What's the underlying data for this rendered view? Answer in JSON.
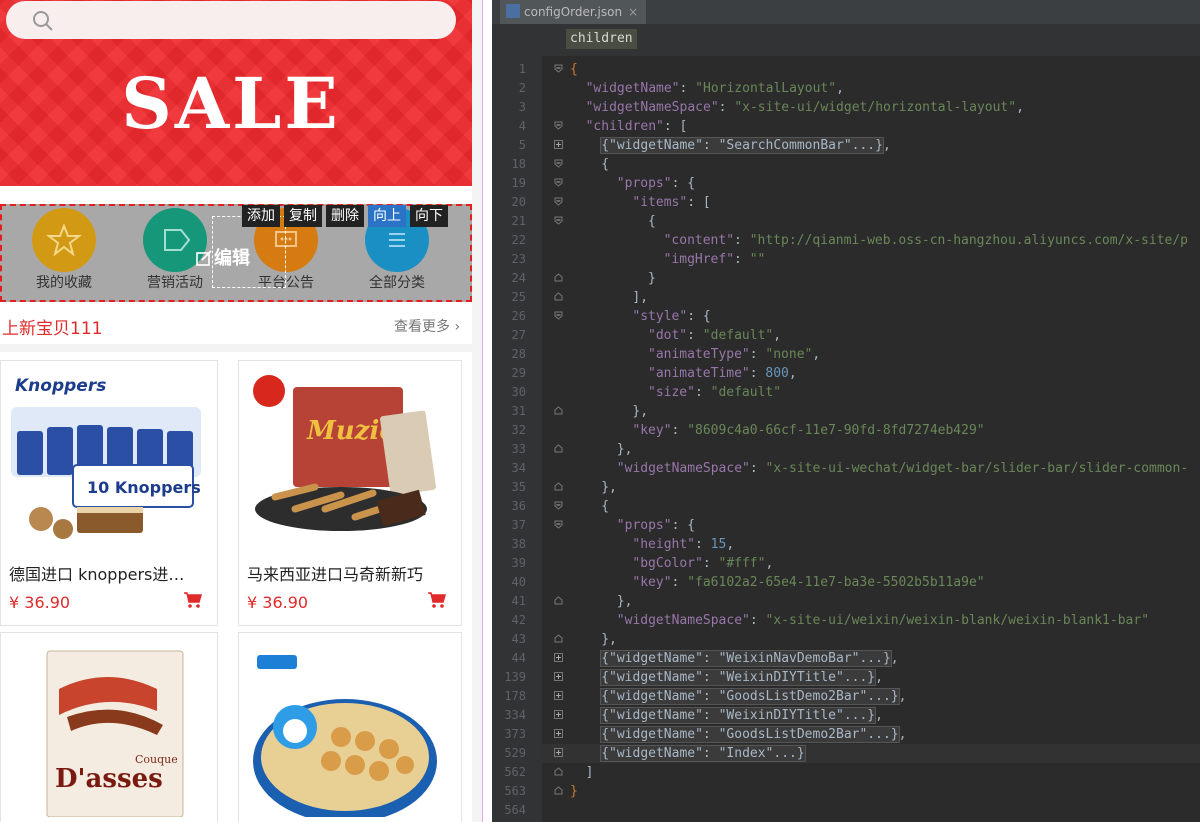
{
  "preview": {
    "banner_text": "SALE",
    "nav_items": [
      {
        "label": "我的收藏",
        "color": "#d29a14"
      },
      {
        "label": "营销活动",
        "color": "#16977a"
      },
      {
        "label": "平台公告",
        "color": "#d67b12"
      },
      {
        "label": "全部分类",
        "color": "#1a8fc4"
      }
    ],
    "actions": [
      "添加",
      "复制",
      "删除",
      "向上",
      "向下"
    ],
    "edit_overlay": "编辑",
    "section_title": "上新宝贝111",
    "more_link": "查看更多",
    "goods": [
      {
        "name": "德国进口 knoppers进…",
        "price": "¥ 36.90"
      },
      {
        "name": "马来西亚进口马奇新新巧",
        "price": "¥ 36.90"
      }
    ],
    "image_texts": {
      "knoppers_logo": "Knoppers",
      "knoppers_pack": "10 Knoppers",
      "muzic": "Muzic",
      "dasses_1": "Couque",
      "dasses_2": "D'asses"
    }
  },
  "editor": {
    "tab_label": "configOrder.json",
    "breadcrumb": "children",
    "lines": [
      {
        "num": "1",
        "indent": 0,
        "tokens": [
          [
            "p",
            "{"
          ]
        ]
      },
      {
        "num": "2",
        "indent": 1,
        "tokens": [
          [
            "k",
            "\"widgetName\""
          ],
          [
            "t",
            ": "
          ],
          [
            "s",
            "\"HorizontalLayout\""
          ],
          [
            "t",
            ","
          ]
        ]
      },
      {
        "num": "3",
        "indent": 1,
        "tokens": [
          [
            "k",
            "\"widgetNameSpace\""
          ],
          [
            "t",
            ": "
          ],
          [
            "s",
            "\"x-site-ui/widget/horizontal-layout\""
          ],
          [
            "t",
            ","
          ]
        ]
      },
      {
        "num": "4",
        "indent": 1,
        "tokens": [
          [
            "k",
            "\"children\""
          ],
          [
            "t",
            ": ["
          ]
        ]
      },
      {
        "num": "5",
        "indent": 2,
        "tokens": [
          [
            "c",
            "{\"widgetName\": \"SearchCommonBar\"...}"
          ],
          [
            "t",
            ","
          ]
        ]
      },
      {
        "num": "18",
        "indent": 2,
        "tokens": [
          [
            "t",
            "{"
          ]
        ]
      },
      {
        "num": "19",
        "indent": 3,
        "tokens": [
          [
            "k",
            "\"props\""
          ],
          [
            "t",
            ": {"
          ]
        ]
      },
      {
        "num": "20",
        "indent": 4,
        "tokens": [
          [
            "k",
            "\"items\""
          ],
          [
            "t",
            ": ["
          ]
        ]
      },
      {
        "num": "21",
        "indent": 5,
        "tokens": [
          [
            "t",
            "{"
          ]
        ]
      },
      {
        "num": "22",
        "indent": 6,
        "tokens": [
          [
            "k",
            "\"content\""
          ],
          [
            "t",
            ": "
          ],
          [
            "s",
            "\"http://qianmi-web.oss-cn-hangzhou.aliyuncs.com/x-site/p"
          ]
        ]
      },
      {
        "num": "23",
        "indent": 6,
        "tokens": [
          [
            "k",
            "\"imgHref\""
          ],
          [
            "t",
            ": "
          ],
          [
            "s",
            "\"\""
          ]
        ]
      },
      {
        "num": "24",
        "indent": 5,
        "tokens": [
          [
            "t",
            "}"
          ]
        ]
      },
      {
        "num": "25",
        "indent": 4,
        "tokens": [
          [
            "t",
            "],"
          ]
        ]
      },
      {
        "num": "26",
        "indent": 4,
        "tokens": [
          [
            "k",
            "\"style\""
          ],
          [
            "t",
            ": {"
          ]
        ]
      },
      {
        "num": "27",
        "indent": 5,
        "tokens": [
          [
            "k",
            "\"dot\""
          ],
          [
            "t",
            ": "
          ],
          [
            "s",
            "\"default\""
          ],
          [
            "t",
            ","
          ]
        ]
      },
      {
        "num": "28",
        "indent": 5,
        "tokens": [
          [
            "k",
            "\"animateType\""
          ],
          [
            "t",
            ": "
          ],
          [
            "s",
            "\"none\""
          ],
          [
            "t",
            ","
          ]
        ]
      },
      {
        "num": "29",
        "indent": 5,
        "tokens": [
          [
            "k",
            "\"animateTime\""
          ],
          [
            "t",
            ": "
          ],
          [
            "n",
            "800"
          ],
          [
            "t",
            ","
          ]
        ]
      },
      {
        "num": "30",
        "indent": 5,
        "tokens": [
          [
            "k",
            "\"size\""
          ],
          [
            "t",
            ": "
          ],
          [
            "s",
            "\"default\""
          ]
        ]
      },
      {
        "num": "31",
        "indent": 4,
        "tokens": [
          [
            "t",
            "},"
          ]
        ]
      },
      {
        "num": "32",
        "indent": 4,
        "tokens": [
          [
            "k",
            "\"key\""
          ],
          [
            "t",
            ": "
          ],
          [
            "s",
            "\"8609c4a0-66cf-11e7-90fd-8fd7274eb429\""
          ]
        ]
      },
      {
        "num": "33",
        "indent": 3,
        "tokens": [
          [
            "t",
            "},"
          ]
        ]
      },
      {
        "num": "34",
        "indent": 3,
        "tokens": [
          [
            "k",
            "\"widgetNameSpace\""
          ],
          [
            "t",
            ": "
          ],
          [
            "s",
            "\"x-site-ui-wechat/widget-bar/slider-bar/slider-common-"
          ]
        ]
      },
      {
        "num": "35",
        "indent": 2,
        "tokens": [
          [
            "t",
            "},"
          ]
        ]
      },
      {
        "num": "36",
        "indent": 2,
        "tokens": [
          [
            "t",
            "{"
          ]
        ]
      },
      {
        "num": "37",
        "indent": 3,
        "tokens": [
          [
            "k",
            "\"props\""
          ],
          [
            "t",
            ": {"
          ]
        ]
      },
      {
        "num": "38",
        "indent": 4,
        "tokens": [
          [
            "k",
            "\"height\""
          ],
          [
            "t",
            ": "
          ],
          [
            "n",
            "15"
          ],
          [
            "t",
            ","
          ]
        ]
      },
      {
        "num": "39",
        "indent": 4,
        "tokens": [
          [
            "k",
            "\"bgColor\""
          ],
          [
            "t",
            ": "
          ],
          [
            "s",
            "\"#fff\""
          ],
          [
            "t",
            ","
          ]
        ]
      },
      {
        "num": "40",
        "indent": 4,
        "tokens": [
          [
            "k",
            "\"key\""
          ],
          [
            "t",
            ": "
          ],
          [
            "s",
            "\"fa6102a2-65e4-11e7-ba3e-5502b5b11a9e\""
          ]
        ]
      },
      {
        "num": "41",
        "indent": 3,
        "tokens": [
          [
            "t",
            "},"
          ]
        ]
      },
      {
        "num": "42",
        "indent": 3,
        "tokens": [
          [
            "k",
            "\"widgetNameSpace\""
          ],
          [
            "t",
            ": "
          ],
          [
            "s",
            "\"x-site-ui/weixin/weixin-blank/weixin-blank1-bar\""
          ]
        ]
      },
      {
        "num": "43",
        "indent": 2,
        "tokens": [
          [
            "t",
            "},"
          ]
        ]
      },
      {
        "num": "44",
        "indent": 2,
        "tokens": [
          [
            "c",
            "{\"widgetName\": \"WeixinNavDemoBar\"...}"
          ],
          [
            "t",
            ","
          ]
        ]
      },
      {
        "num": "139",
        "indent": 2,
        "tokens": [
          [
            "c",
            "{\"widgetName\": \"WeixinDIYTitle\"...}"
          ],
          [
            "t",
            ","
          ]
        ]
      },
      {
        "num": "178",
        "indent": 2,
        "tokens": [
          [
            "c",
            "{\"widgetName\": \"GoodsListDemo2Bar\"...}"
          ],
          [
            "t",
            ","
          ]
        ]
      },
      {
        "num": "334",
        "indent": 2,
        "tokens": [
          [
            "c",
            "{\"widgetName\": \"WeixinDIYTitle\"...}"
          ],
          [
            "t",
            ","
          ]
        ]
      },
      {
        "num": "373",
        "indent": 2,
        "tokens": [
          [
            "c",
            "{\"widgetName\": \"GoodsListDemo2Bar\"...}"
          ],
          [
            "t",
            ","
          ]
        ]
      },
      {
        "num": "529",
        "indent": 2,
        "tokens": [
          [
            "c",
            "{\"widgetName\": \"Index\"...}"
          ]
        ]
      },
      {
        "num": "562",
        "indent": 1,
        "tokens": [
          [
            "t",
            "]"
          ]
        ]
      },
      {
        "num": "563",
        "indent": 0,
        "tokens": [
          [
            "p",
            "}"
          ]
        ]
      },
      {
        "num": "564",
        "indent": 0,
        "tokens": []
      }
    ],
    "current_line": "529",
    "colors": {
      "key": "#9876aa",
      "string": "#6a8759",
      "number": "#6897bb",
      "text": "#a9b7c6"
    }
  }
}
